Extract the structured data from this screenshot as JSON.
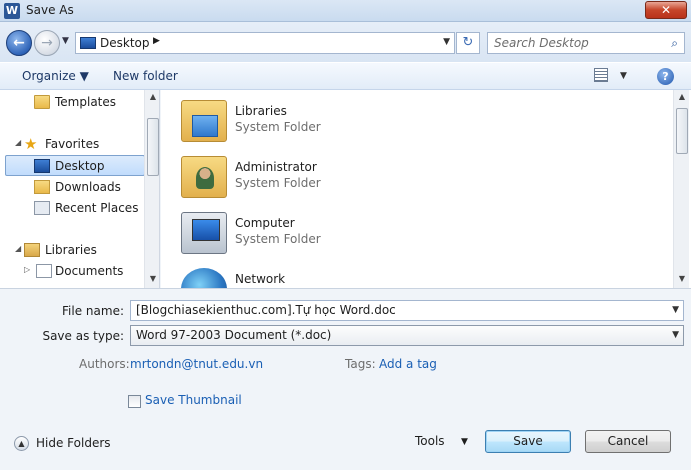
{
  "window": {
    "title": "Save As",
    "close_label": "✕"
  },
  "address_bar": {
    "location": "Desktop",
    "search_placeholder": "Search Desktop"
  },
  "toolbar": {
    "organize_label": "Organize ▼",
    "new_folder_label": "New folder",
    "help_label": "?"
  },
  "nav_pane": {
    "items": [
      {
        "label": "Templates"
      },
      {
        "label": "Favorites"
      },
      {
        "label": "Desktop"
      },
      {
        "label": "Downloads"
      },
      {
        "label": "Recent Places"
      },
      {
        "label": "Libraries"
      },
      {
        "label": "Documents"
      }
    ]
  },
  "content": {
    "entries": [
      {
        "name": "Libraries",
        "type": "System Folder",
        "icon": "libraries-icon"
      },
      {
        "name": "Administrator",
        "type": "System Folder",
        "icon": "user-folder-icon"
      },
      {
        "name": "Computer",
        "type": "System Folder",
        "icon": "computer-icon"
      },
      {
        "name": "Network",
        "type": "",
        "icon": "network-icon"
      }
    ]
  },
  "form": {
    "file_name_label": "File name:",
    "file_name_value": "[Blogchiasekienthuc.com].Tự học Word.doc",
    "save_type_label": "Save as type:",
    "save_type_value": "Word 97-2003 Document (*.doc)",
    "authors_label": "Authors:",
    "authors_value": "mrtondn@tnut.edu.vn",
    "tags_label": "Tags:",
    "tags_value": "Add a tag",
    "thumbnail_label": "Save Thumbnail",
    "thumbnail_checked": false
  },
  "footer": {
    "hide_folders_label": "Hide Folders",
    "tools_label": "Tools",
    "save_label": "Save",
    "cancel_label": "Cancel"
  }
}
